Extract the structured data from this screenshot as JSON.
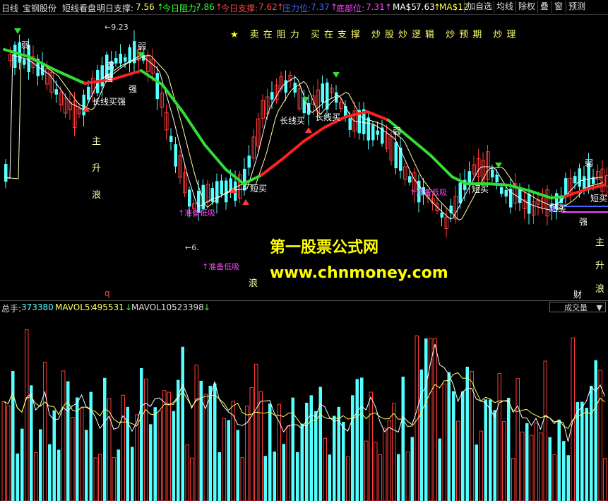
{
  "header": {
    "period": "日线",
    "stock": "宝钢股份",
    "indicator": "短线看盘",
    "next_support_label": "明日支撑:",
    "next_support_value": "7.56",
    "today_resist_label": "今日阻力:",
    "today_resist_value": "7.86",
    "today_support_label": "今日支撑:",
    "today_support_value": "7.62",
    "pressure_label": "压力位:",
    "pressure_value": "7.37",
    "bottom_label": "底部位:",
    "bottom_value": "7.31",
    "ma5_label": "MA$5:",
    "ma5_value": "7.63",
    "ma12_label": "MA$12"
  },
  "toolbar": [
    "加自选",
    "均线",
    "除权",
    "叠",
    "窗",
    "预测"
  ],
  "marquee": "卖在阻力 买在支撑  炒股炒逻辑  炒预期  炒理",
  "annotations": {
    "high_price": "9.23",
    "low_price": "6.",
    "weak": "弱",
    "strong": "强",
    "long_buy": "长线买",
    "short_buy": "短买",
    "prepare_dip": "准备低吸",
    "main_up_wave": [
      "主",
      "升",
      "浪"
    ],
    "wave": "浪",
    "cai": "财",
    "q": "q"
  },
  "watermark": {
    "title": "第一股票公式网",
    "url": "www.chnmoney.com"
  },
  "volume_header": {
    "total_label": "总手:",
    "total_value": "373380",
    "mavol5_label": "MAVOL5:",
    "mavol5_value": "495531",
    "mavol10_label": "MAVOL10:",
    "mavol10_value": "523398",
    "select_value": "成交量"
  },
  "colors": {
    "up": "#ff3a3a",
    "down": "#54ffff",
    "long_line_up": "#ff2020",
    "long_line_down": "#33dd33",
    "yellow": "#ffff00",
    "magenta": "#ff44ff"
  }
}
